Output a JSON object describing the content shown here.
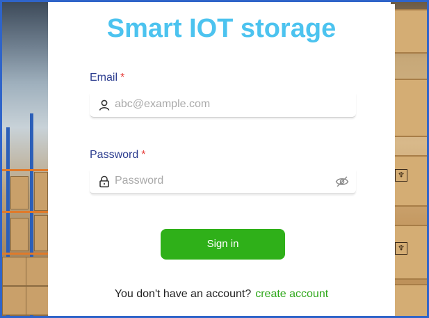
{
  "app": {
    "title": "Smart IOT storage"
  },
  "form": {
    "email": {
      "label": "Email",
      "required_mark": "*",
      "placeholder": "abc@example.com",
      "icon": "user-icon"
    },
    "password": {
      "label": "Password",
      "required_mark": "*",
      "placeholder": "Password",
      "icon": "lock-icon",
      "toggle_icon": "eye-off-icon"
    },
    "submit_label": "Sign in"
  },
  "footer": {
    "prompt": "You don't have an account?",
    "link_label": "create account"
  },
  "colors": {
    "title": "#4cc3ef",
    "label": "#2b3c8f",
    "required": "#e53935",
    "button": "#2fb019",
    "link": "#2fa81b",
    "frame_border": "#2f64c9"
  }
}
